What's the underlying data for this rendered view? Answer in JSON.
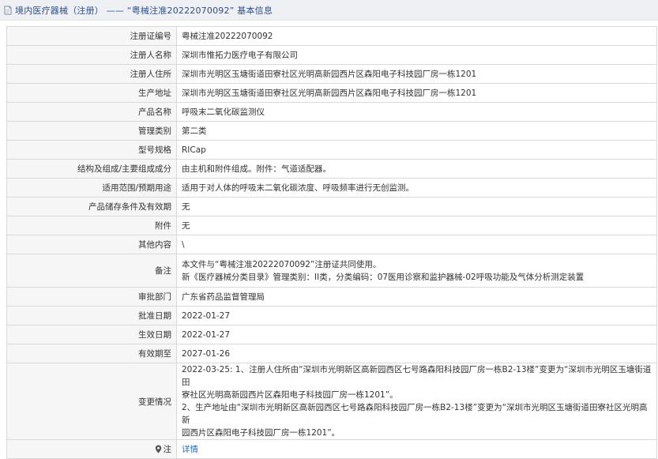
{
  "header": {
    "title": "境内医疗器械（注册） —— “粤械注准20222070092” 基本信息"
  },
  "rows": [
    {
      "label": "注册证编号",
      "lines": [
        "粤械注准20222070092"
      ]
    },
    {
      "label": "注册人名称",
      "lines": [
        "深圳市惟拓力医疗电子有限公司"
      ]
    },
    {
      "label": "注册人住所",
      "lines": [
        "深圳市光明区玉塘街道田寮社区光明高新园西片区森阳电子科技园厂房一栋1201"
      ]
    },
    {
      "label": "生产地址",
      "lines": [
        "深圳市光明区玉塘街道田寮社区光明高新园西片区森阳电子科技园厂房一栋1201"
      ]
    },
    {
      "label": "产品名称",
      "lines": [
        "呼吸末二氧化碳监测仪"
      ]
    },
    {
      "label": "管理类别",
      "lines": [
        "第二类"
      ]
    },
    {
      "label": "型号规格",
      "lines": [
        "RICap"
      ]
    },
    {
      "label": "结构及组成/主要组成成分",
      "lines": [
        "由主机和附件组成。附件：气道适配器。"
      ]
    },
    {
      "label": "适用范围/预期用途",
      "lines": [
        "适用于对人体的呼吸末二氧化碳浓度、呼吸频率进行无创监测。"
      ]
    },
    {
      "label": "产品储存条件及有效期",
      "lines": [
        "无"
      ]
    },
    {
      "label": "附件",
      "lines": [
        "无"
      ]
    },
    {
      "label": "其他内容",
      "lines": [
        "\\"
      ]
    },
    {
      "label": "备注",
      "lines": [
        "本文件与“粤械注准20222070092”注册证共同使用。",
        "新《医疗器械分类目录》管理类别：II类，分类编码：07医用诊察和监护器械-02呼吸功能及气体分析测定装置"
      ]
    },
    {
      "label": "审批部门",
      "lines": [
        "广东省药品监督管理局"
      ]
    },
    {
      "label": "批准日期",
      "lines": [
        "2022-01-27"
      ]
    },
    {
      "label": "生效日期",
      "lines": [
        "2022-01-27"
      ]
    },
    {
      "label": "有效期至",
      "lines": [
        "2027-01-26"
      ]
    },
    {
      "label": "变更情况",
      "lines": [
        "2022-03-25: 1、注册人住所由“深圳市光明新区高新园西区七号路森阳科技园厂房一栋B2-13楼”变更为“深圳市光明区玉塘街道田",
        "寮社区光明高新园西片区森阳电子科技园厂房一栋1201”。",
        "2、生产地址由“深圳市光明新区高新园西区七号路森阳科技园厂房一栋B2-13楼”变更为“深圳市光明区玉塘街道田寮社区光明高新",
        "园西片区森阳电子科技园厂房一栋1201”。"
      ]
    }
  ],
  "footer": {
    "label": "注",
    "link": "详情"
  }
}
